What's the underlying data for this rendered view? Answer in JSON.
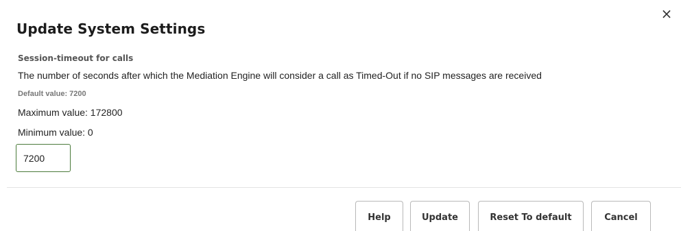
{
  "dialog": {
    "title": "Update System Settings",
    "close_glyph": "×"
  },
  "setting": {
    "name": "Session-timeout for calls",
    "description": "The number of seconds after which the Mediation Engine will consider a call as Timed-Out if no SIP messages are received",
    "default_value": "Default value: 7200",
    "maximum_value": "Maximum value: 172800",
    "minimum_value": "Minimum value: 0",
    "current_value": "7200"
  },
  "buttons": {
    "help": "Help",
    "update": "Update",
    "reset": "Reset To default",
    "cancel": "Cancel"
  },
  "colors": {
    "input_border": "#4a7a3a",
    "divider": "#e3e3e3"
  },
  "icons": {
    "close": "close-icon"
  }
}
